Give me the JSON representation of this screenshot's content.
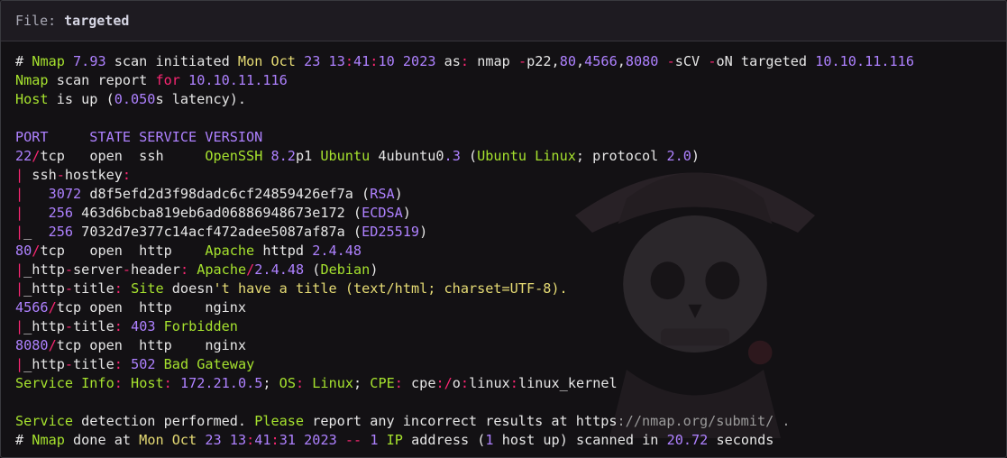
{
  "window": {
    "file_label": "File:",
    "file_name": "targeted"
  },
  "colors": {
    "green": "#a6e22e",
    "yellow": "#e6db74",
    "purple": "#ae81ff",
    "pink": "#f92672",
    "text": "#e6e6e6",
    "background": "#131114"
  },
  "background_art": "skull-pirate-icon",
  "lines": [
    [
      {
        "t": "# ",
        "c": "w"
      },
      {
        "t": "Nmap",
        "c": "g"
      },
      {
        "t": " ",
        "c": "w"
      },
      {
        "t": "7.93",
        "c": "p"
      },
      {
        "t": " scan initiated ",
        "c": "w"
      },
      {
        "t": "Mon Oct",
        "c": "y"
      },
      {
        "t": " ",
        "c": "w"
      },
      {
        "t": "23",
        "c": "p"
      },
      {
        "t": " ",
        "c": "w"
      },
      {
        "t": "13",
        "c": "p"
      },
      {
        "t": ":",
        "c": "r"
      },
      {
        "t": "41",
        "c": "p"
      },
      {
        "t": ":",
        "c": "r"
      },
      {
        "t": "10",
        "c": "p"
      },
      {
        "t": " ",
        "c": "w"
      },
      {
        "t": "2023",
        "c": "p"
      },
      {
        "t": " as",
        "c": "w"
      },
      {
        "t": ":",
        "c": "r"
      },
      {
        "t": " nmap ",
        "c": "w"
      },
      {
        "t": "-",
        "c": "r"
      },
      {
        "t": "p22,",
        "c": "w"
      },
      {
        "t": "80",
        "c": "p"
      },
      {
        "t": ",",
        "c": "w"
      },
      {
        "t": "4566",
        "c": "p"
      },
      {
        "t": ",",
        "c": "w"
      },
      {
        "t": "8080",
        "c": "p"
      },
      {
        "t": " ",
        "c": "w"
      },
      {
        "t": "-",
        "c": "r"
      },
      {
        "t": "sCV ",
        "c": "w"
      },
      {
        "t": "-",
        "c": "r"
      },
      {
        "t": "oN targeted ",
        "c": "w"
      },
      {
        "t": "10.10.11.116",
        "c": "p"
      }
    ],
    [
      {
        "t": "Nmap",
        "c": "g"
      },
      {
        "t": " scan report ",
        "c": "w"
      },
      {
        "t": "for",
        "c": "r"
      },
      {
        "t": " ",
        "c": "w"
      },
      {
        "t": "10.10.11.116",
        "c": "p"
      }
    ],
    [
      {
        "t": "Host",
        "c": "g"
      },
      {
        "t": " is up (",
        "c": "w"
      },
      {
        "t": "0.050",
        "c": "p"
      },
      {
        "t": "s latency).",
        "c": "w"
      }
    ],
    [],
    [
      {
        "t": "PORT     STATE SERVICE VERSION",
        "c": "p"
      }
    ],
    [
      {
        "t": "22",
        "c": "p"
      },
      {
        "t": "/",
        "c": "r"
      },
      {
        "t": "tcp   open  ssh     ",
        "c": "w"
      },
      {
        "t": "OpenSSH",
        "c": "g"
      },
      {
        "t": " ",
        "c": "w"
      },
      {
        "t": "8.2",
        "c": "p"
      },
      {
        "t": "p1 ",
        "c": "w"
      },
      {
        "t": "Ubuntu",
        "c": "g"
      },
      {
        "t": " 4ubuntu0",
        "c": "w"
      },
      {
        "t": ".3",
        "c": "p"
      },
      {
        "t": " (",
        "c": "w"
      },
      {
        "t": "Ubuntu Linux",
        "c": "g"
      },
      {
        "t": "; protocol ",
        "c": "w"
      },
      {
        "t": "2.0",
        "c": "p"
      },
      {
        "t": ")",
        "c": "w"
      }
    ],
    [
      {
        "t": "|",
        "c": "r"
      },
      {
        "t": " ssh",
        "c": "w"
      },
      {
        "t": "-",
        "c": "r"
      },
      {
        "t": "hostkey",
        "c": "w"
      },
      {
        "t": ":",
        "c": "r"
      }
    ],
    [
      {
        "t": "|",
        "c": "r"
      },
      {
        "t": "   ",
        "c": "w"
      },
      {
        "t": "3072",
        "c": "p"
      },
      {
        "t": " d8f5efd2d3f98dadc6cf24859426ef7a (",
        "c": "w"
      },
      {
        "t": "RSA",
        "c": "p"
      },
      {
        "t": ")",
        "c": "w"
      }
    ],
    [
      {
        "t": "|",
        "c": "r"
      },
      {
        "t": "   ",
        "c": "w"
      },
      {
        "t": "256",
        "c": "p"
      },
      {
        "t": " 463d6bcba819eb6ad06886948673e172 (",
        "c": "w"
      },
      {
        "t": "ECDSA",
        "c": "p"
      },
      {
        "t": ")",
        "c": "w"
      }
    ],
    [
      {
        "t": "|",
        "c": "r"
      },
      {
        "t": "_  ",
        "c": "w"
      },
      {
        "t": "256",
        "c": "p"
      },
      {
        "t": " 7032d7e377c14acf472adee5087af87a (",
        "c": "w"
      },
      {
        "t": "ED25519",
        "c": "p"
      },
      {
        "t": ")",
        "c": "w"
      }
    ],
    [
      {
        "t": "80",
        "c": "p"
      },
      {
        "t": "/",
        "c": "r"
      },
      {
        "t": "tcp   open  http    ",
        "c": "w"
      },
      {
        "t": "Apache",
        "c": "g"
      },
      {
        "t": " httpd ",
        "c": "w"
      },
      {
        "t": "2.4.48",
        "c": "p"
      }
    ],
    [
      {
        "t": "|",
        "c": "r"
      },
      {
        "t": "_http",
        "c": "w"
      },
      {
        "t": "-",
        "c": "r"
      },
      {
        "t": "server",
        "c": "w"
      },
      {
        "t": "-",
        "c": "r"
      },
      {
        "t": "header",
        "c": "w"
      },
      {
        "t": ":",
        "c": "r"
      },
      {
        "t": " ",
        "c": "w"
      },
      {
        "t": "Apache",
        "c": "g"
      },
      {
        "t": "/",
        "c": "r"
      },
      {
        "t": "2.4.48",
        "c": "p"
      },
      {
        "t": " (",
        "c": "w"
      },
      {
        "t": "Debian",
        "c": "g"
      },
      {
        "t": ")",
        "c": "w"
      }
    ],
    [
      {
        "t": "|",
        "c": "r"
      },
      {
        "t": "_http",
        "c": "w"
      },
      {
        "t": "-",
        "c": "r"
      },
      {
        "t": "title",
        "c": "w"
      },
      {
        "t": ":",
        "c": "r"
      },
      {
        "t": " ",
        "c": "w"
      },
      {
        "t": "Site",
        "c": "g"
      },
      {
        "t": " doesn",
        "c": "w"
      },
      {
        "t": "'t have a title (text/html; charset=UTF-8).",
        "c": "y"
      }
    ],
    [
      {
        "t": "4566",
        "c": "p"
      },
      {
        "t": "/",
        "c": "r"
      },
      {
        "t": "tcp open  http    nginx",
        "c": "w"
      }
    ],
    [
      {
        "t": "|",
        "c": "r"
      },
      {
        "t": "_http",
        "c": "w"
      },
      {
        "t": "-",
        "c": "r"
      },
      {
        "t": "title",
        "c": "w"
      },
      {
        "t": ":",
        "c": "r"
      },
      {
        "t": " ",
        "c": "w"
      },
      {
        "t": "403",
        "c": "p"
      },
      {
        "t": " ",
        "c": "w"
      },
      {
        "t": "Forbidden",
        "c": "g"
      }
    ],
    [
      {
        "t": "8080",
        "c": "p"
      },
      {
        "t": "/",
        "c": "r"
      },
      {
        "t": "tcp open  http    nginx",
        "c": "w"
      }
    ],
    [
      {
        "t": "|",
        "c": "r"
      },
      {
        "t": "_http",
        "c": "w"
      },
      {
        "t": "-",
        "c": "r"
      },
      {
        "t": "title",
        "c": "w"
      },
      {
        "t": ":",
        "c": "r"
      },
      {
        "t": " ",
        "c": "w"
      },
      {
        "t": "502",
        "c": "p"
      },
      {
        "t": " ",
        "c": "w"
      },
      {
        "t": "Bad Gateway",
        "c": "g"
      }
    ],
    [
      {
        "t": "Service Info",
        "c": "g"
      },
      {
        "t": ":",
        "c": "r"
      },
      {
        "t": " ",
        "c": "w"
      },
      {
        "t": "Host",
        "c": "g"
      },
      {
        "t": ":",
        "c": "r"
      },
      {
        "t": " ",
        "c": "w"
      },
      {
        "t": "172.21.0.5",
        "c": "p"
      },
      {
        "t": "; ",
        "c": "w"
      },
      {
        "t": "OS",
        "c": "g"
      },
      {
        "t": ":",
        "c": "r"
      },
      {
        "t": " ",
        "c": "w"
      },
      {
        "t": "Linux",
        "c": "g"
      },
      {
        "t": "; ",
        "c": "w"
      },
      {
        "t": "CPE",
        "c": "g"
      },
      {
        "t": ":",
        "c": "r"
      },
      {
        "t": " cpe",
        "c": "w"
      },
      {
        "t": ":/",
        "c": "r"
      },
      {
        "t": "o",
        "c": "w"
      },
      {
        "t": ":",
        "c": "r"
      },
      {
        "t": "linux",
        "c": "w"
      },
      {
        "t": ":",
        "c": "r"
      },
      {
        "t": "linux_kernel",
        "c": "w"
      }
    ],
    [],
    [
      {
        "t": "Service",
        "c": "g"
      },
      {
        "t": " detection performed. ",
        "c": "w"
      },
      {
        "t": "Please",
        "c": "g"
      },
      {
        "t": " report any incorrect results at https",
        "c": "w"
      },
      {
        "t": "://nmap.org/submit/ .",
        "c": "d"
      }
    ],
    [
      {
        "t": "# ",
        "c": "w"
      },
      {
        "t": "Nmap",
        "c": "g"
      },
      {
        "t": " done at ",
        "c": "w"
      },
      {
        "t": "Mon Oct",
        "c": "y"
      },
      {
        "t": " ",
        "c": "w"
      },
      {
        "t": "23",
        "c": "p"
      },
      {
        "t": " ",
        "c": "w"
      },
      {
        "t": "13",
        "c": "p"
      },
      {
        "t": ":",
        "c": "r"
      },
      {
        "t": "41",
        "c": "p"
      },
      {
        "t": ":",
        "c": "r"
      },
      {
        "t": "31",
        "c": "p"
      },
      {
        "t": " ",
        "c": "w"
      },
      {
        "t": "2023",
        "c": "p"
      },
      {
        "t": " ",
        "c": "w"
      },
      {
        "t": "--",
        "c": "r"
      },
      {
        "t": " ",
        "c": "w"
      },
      {
        "t": "1",
        "c": "p"
      },
      {
        "t": " ",
        "c": "w"
      },
      {
        "t": "IP",
        "c": "g"
      },
      {
        "t": " address (",
        "c": "w"
      },
      {
        "t": "1",
        "c": "p"
      },
      {
        "t": " host up) scanned in ",
        "c": "w"
      },
      {
        "t": "20.72",
        "c": "p"
      },
      {
        "t": " seconds",
        "c": "w"
      }
    ]
  ]
}
